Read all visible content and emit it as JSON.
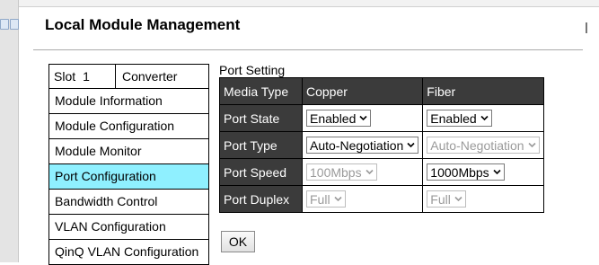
{
  "page": {
    "title": "Local Module Management"
  },
  "menu": {
    "slot_label": "Slot",
    "slot_number": "1",
    "converter_label": "Converter",
    "items": [
      {
        "label": "Module Information"
      },
      {
        "label": "Module Configuration"
      },
      {
        "label": "Module Monitor"
      },
      {
        "label": "Port Configuration",
        "active": true
      },
      {
        "label": "Bandwidth Control"
      },
      {
        "label": "VLAN Configuration"
      },
      {
        "label": "QinQ VLAN Configuration"
      }
    ],
    "active_color": "#8ff0ff"
  },
  "port_setting": {
    "section_label": "Port Setting",
    "header": {
      "label": "Media Type",
      "copper": "Copper",
      "fiber": "Fiber"
    },
    "rows": [
      {
        "label": "Port State",
        "copper": {
          "value": "Enabled",
          "disabled": false
        },
        "fiber": {
          "value": "Enabled",
          "disabled": false
        }
      },
      {
        "label": "Port Type",
        "copper": {
          "value": "Auto-Negotiation",
          "disabled": false
        },
        "fiber": {
          "value": "Auto-Negotiation",
          "disabled": true
        }
      },
      {
        "label": "Port Speed",
        "copper": {
          "value": "100Mbps",
          "disabled": true
        },
        "fiber": {
          "value": "1000Mbps",
          "disabled": false
        }
      },
      {
        "label": "Port Duplex",
        "copper": {
          "value": "Full",
          "disabled": true
        },
        "fiber": {
          "value": "Full",
          "disabled": true
        }
      }
    ],
    "header_bg": "#3b3b3b",
    "ok_label": "OK"
  }
}
